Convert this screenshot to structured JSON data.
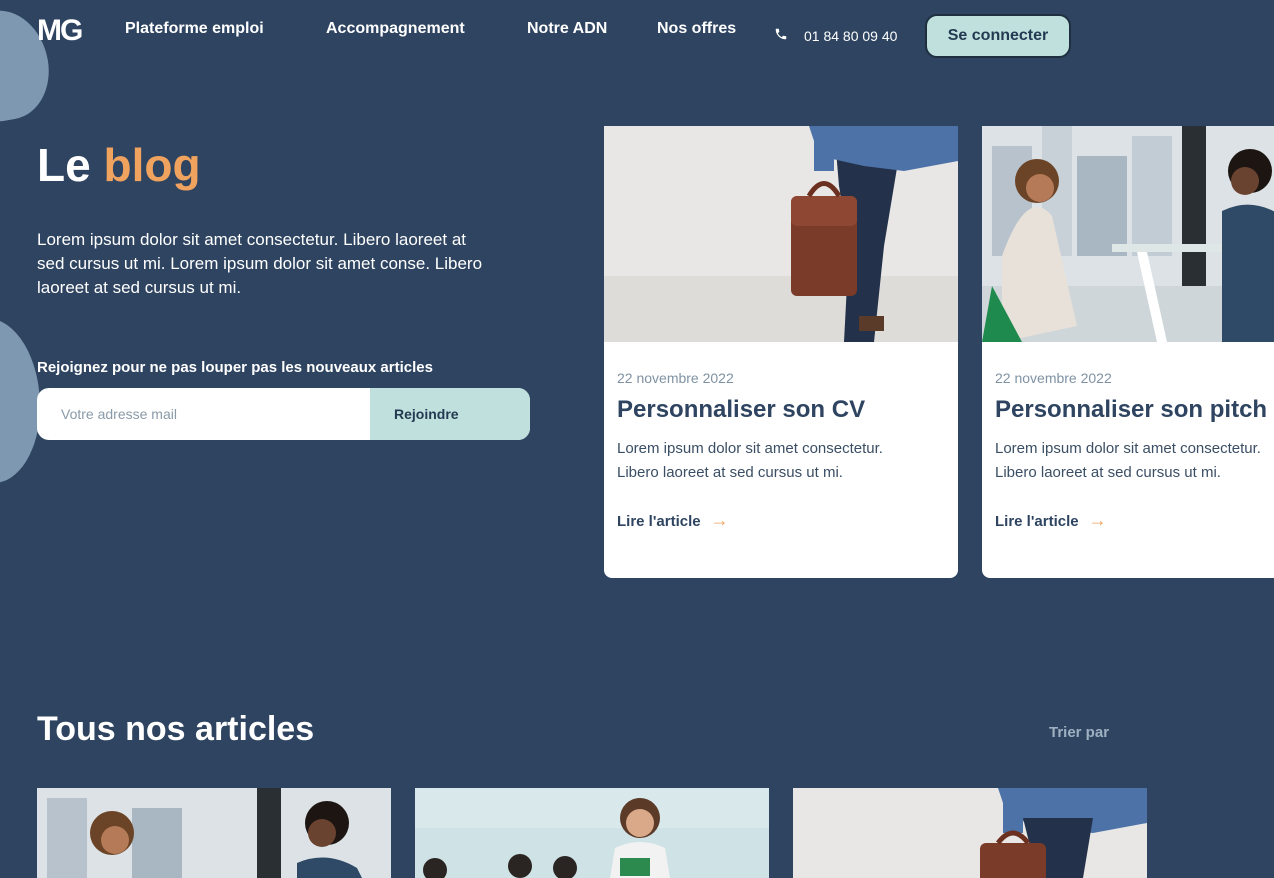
{
  "nav": {
    "logo": "MG",
    "links": [
      "Plateforme emploi",
      "Accompagnement",
      "Notre ADN",
      "Nos offres"
    ],
    "phone": "01 84 80 09 40",
    "login": "Se connecter"
  },
  "hero": {
    "title_part1": "Le ",
    "title_part2": "blog",
    "text": "Lorem ipsum dolor sit amet consectetur. Libero laoreet at sed cursus ut mi. Lorem ipsum dolor sit amet conse. Libero laoreet at sed cursus ut mi.",
    "newsletter_label": "Rejoignez pour ne pas louper pas les nouveaux articles",
    "email_placeholder": "Votre adresse mail",
    "join_label": "Rejoindre"
  },
  "featured": [
    {
      "date": "22 novembre 2022",
      "title": "Personnaliser son CV",
      "text_line1": "Lorem ipsum dolor sit amet consectetur.",
      "text_line2": "Libero laoreet at sed cursus ut mi.",
      "link": "Lire l'article"
    },
    {
      "date": "22 novembre 2022",
      "title": "Personnaliser son pitch",
      "text_line1": "Lorem ipsum dolor sit amet consectetur.",
      "text_line2": "Libero laoreet at sed cursus ut mi.",
      "link": "Lire l'article"
    }
  ],
  "articles": {
    "title": "Tous nos articles",
    "sort_label": "Trier par"
  },
  "colors": {
    "background": "#2e4460",
    "accent": "#f0a25f",
    "mint": "#bfe0dd"
  }
}
